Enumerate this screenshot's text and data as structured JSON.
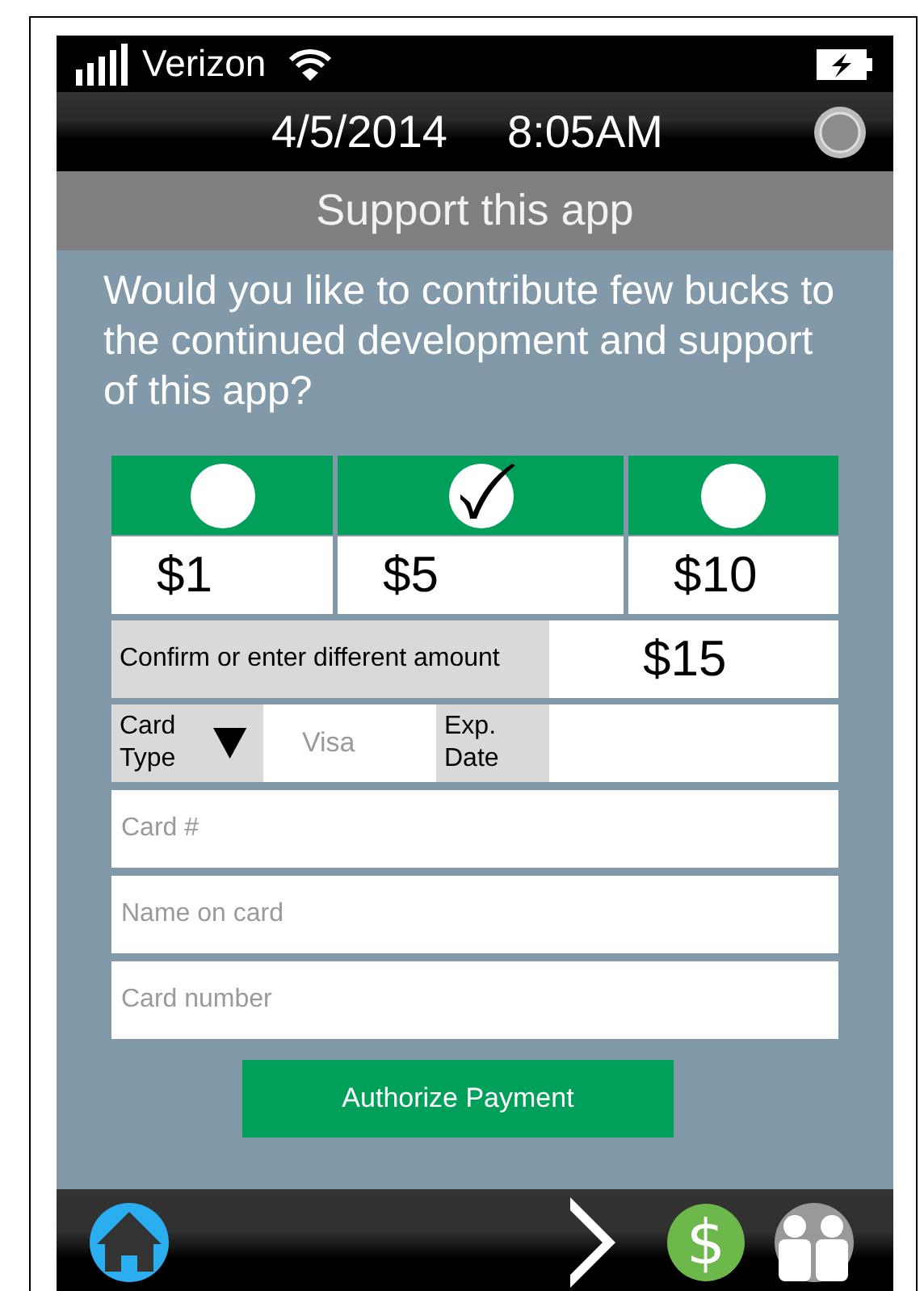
{
  "status_bar": {
    "carrier": "Verizon"
  },
  "date_bar": {
    "date": "4/5/2014",
    "time": "8:05AM"
  },
  "title_bar": {
    "title": "Support this app"
  },
  "prompt": "Would you like to contribute few bucks to the continued development and support of this app?",
  "amounts": [
    {
      "label": "$1",
      "selected": false
    },
    {
      "label": "$5",
      "selected": true
    },
    {
      "label": "$10",
      "selected": false
    }
  ],
  "confirm": {
    "label": "Confirm or enter different amount",
    "value": "$15"
  },
  "card_type": {
    "label": "Card Type",
    "placeholder": "Visa"
  },
  "exp_date": {
    "label": "Exp. Date"
  },
  "fields": [
    {
      "placeholder": "Card #"
    },
    {
      "placeholder": "Name on card"
    },
    {
      "placeholder": "Card number"
    }
  ],
  "button": "Authorize Payment",
  "nav": {
    "payment_symbol": "$"
  }
}
